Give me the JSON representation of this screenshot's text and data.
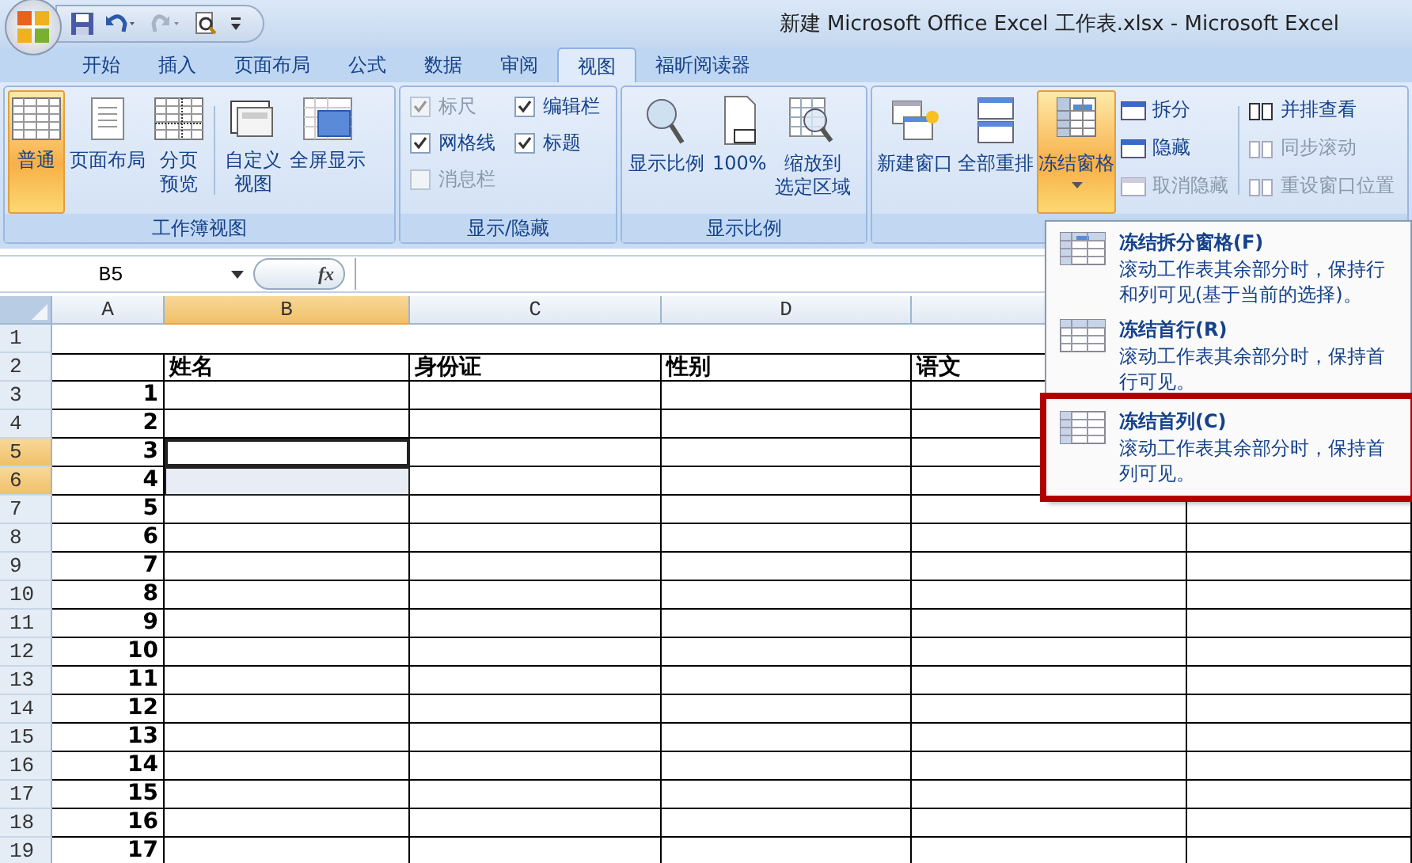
{
  "window": {
    "title": "新建 Microsoft Office Excel 工作表.xlsx - Microsoft Excel"
  },
  "tabs": [
    {
      "label": "开始",
      "selected": false
    },
    {
      "label": "插入",
      "selected": false
    },
    {
      "label": "页面布局",
      "selected": false
    },
    {
      "label": "公式",
      "selected": false
    },
    {
      "label": "数据",
      "selected": false
    },
    {
      "label": "审阅",
      "selected": false
    },
    {
      "label": "视图",
      "selected": true
    },
    {
      "label": "福昕阅读器",
      "selected": false
    }
  ],
  "ribbon": {
    "workbook_views": {
      "label": "工作簿视图",
      "buttons": [
        {
          "lines": [
            "普通"
          ],
          "selected": true
        },
        {
          "lines": [
            "页面布局"
          ],
          "selected": false
        },
        {
          "lines": [
            "分页",
            "预览"
          ],
          "selected": false
        },
        {
          "lines": [
            "自定义",
            "视图"
          ],
          "selected": false
        },
        {
          "lines": [
            "全屏显示"
          ],
          "selected": false
        }
      ]
    },
    "show_hide": {
      "label": "显示/隐藏",
      "checkboxes": [
        {
          "label": "标尺",
          "checked": true,
          "disabled": true
        },
        {
          "label": "编辑栏",
          "checked": true,
          "disabled": false
        },
        {
          "label": "网格线",
          "checked": true,
          "disabled": false
        },
        {
          "label": "标题",
          "checked": true,
          "disabled": false
        },
        {
          "label": "消息栏",
          "checked": false,
          "disabled": true
        }
      ]
    },
    "zoom": {
      "label": "显示比例",
      "buttons": [
        {
          "lines": [
            "显示比例"
          ]
        },
        {
          "lines": [
            "100%"
          ]
        },
        {
          "lines": [
            "缩放到",
            "选定区域"
          ]
        }
      ]
    },
    "window": {
      "large_buttons": [
        {
          "label": "新建窗口",
          "selected": false
        },
        {
          "label": "全部重排",
          "selected": false
        },
        {
          "label": "冻结窗格",
          "selected": true
        }
      ],
      "small_buttons": [
        {
          "label": "拆分",
          "disabled": false
        },
        {
          "label": "隐藏",
          "disabled": false
        },
        {
          "label": "取消隐藏",
          "disabled": true
        },
        {
          "label": "并排查看",
          "disabled": false
        },
        {
          "label": "同步滚动",
          "disabled": true
        },
        {
          "label": "重设窗口位置",
          "disabled": true
        }
      ]
    }
  },
  "formula_bar": {
    "name_box": "B5",
    "function_button": "fx"
  },
  "sheet": {
    "columns": [
      {
        "label": "A",
        "selected": false
      },
      {
        "label": "B",
        "selected": true
      },
      {
        "label": "C",
        "selected": false
      },
      {
        "label": "D",
        "selected": false
      }
    ],
    "rows": [
      {
        "header": "1",
        "selected": false,
        "cells": []
      },
      {
        "header": "2",
        "selected": false,
        "cells": [
          "",
          "姓名",
          "身份证",
          "性别",
          "语文"
        ]
      },
      {
        "header": "3",
        "selected": false,
        "cells": [
          "1"
        ]
      },
      {
        "header": "4",
        "selected": false,
        "cells": [
          "2"
        ]
      },
      {
        "header": "5",
        "selected": true,
        "cells": [
          "3"
        ]
      },
      {
        "header": "6",
        "selected": true,
        "cells": [
          "4"
        ]
      },
      {
        "header": "7",
        "selected": false,
        "cells": [
          "5"
        ]
      },
      {
        "header": "8",
        "selected": false,
        "cells": [
          "6"
        ]
      },
      {
        "header": "9",
        "selected": false,
        "cells": [
          "7"
        ]
      },
      {
        "header": "10",
        "selected": false,
        "cells": [
          "8"
        ]
      },
      {
        "header": "11",
        "selected": false,
        "cells": [
          "9"
        ]
      },
      {
        "header": "12",
        "selected": false,
        "cells": [
          "10"
        ]
      },
      {
        "header": "13",
        "selected": false,
        "cells": [
          "11"
        ]
      },
      {
        "header": "14",
        "selected": false,
        "cells": [
          "12"
        ]
      },
      {
        "header": "15",
        "selected": false,
        "cells": [
          "13"
        ]
      },
      {
        "header": "16",
        "selected": false,
        "cells": [
          "14"
        ]
      },
      {
        "header": "17",
        "selected": false,
        "cells": [
          "15"
        ]
      },
      {
        "header": "18",
        "selected": false,
        "cells": [
          "16"
        ]
      },
      {
        "header": "19",
        "selected": false,
        "cells": [
          "17"
        ]
      }
    ]
  },
  "freeze_menu": {
    "items": [
      {
        "title": "冻结拆分窗格(F)",
        "description": "滚动工作表其余部分时，保持行和列可见(基于当前的选择)。",
        "highlighted": false
      },
      {
        "title": "冻结首行(R)",
        "description": "滚动工作表其余部分时，保持首行可见。",
        "highlighted": false
      },
      {
        "title": "冻结首列(C)",
        "description": "滚动工作表其余部分时，保持首列可见。",
        "highlighted": true
      }
    ]
  }
}
